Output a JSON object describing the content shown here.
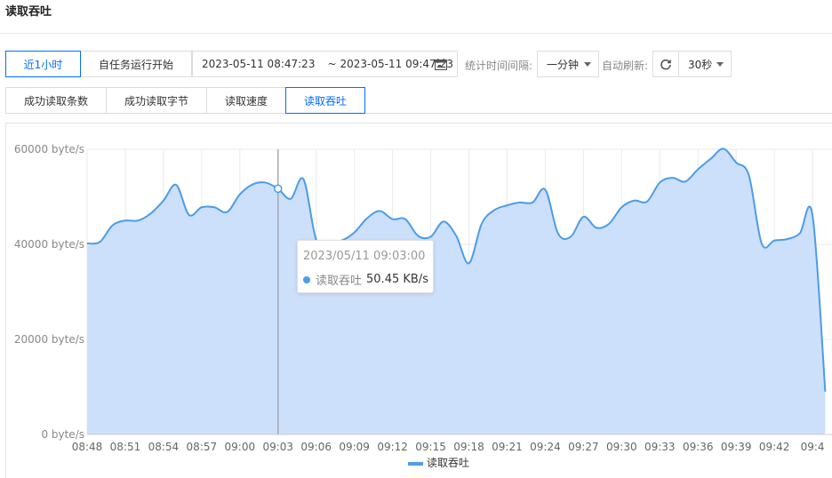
{
  "page": {
    "title": "读取吞吐"
  },
  "toolbar": {
    "range_buttons": [
      "近1小时",
      "自任务运行开始"
    ],
    "date_range": {
      "start": "2023-05-11 08:47:23",
      "separator": "~",
      "end": "2023-05-11 09:47:23"
    },
    "interval_label": "统计时间间隔:",
    "interval_value": "一分钟",
    "auto_refresh_label": "自动刷新:",
    "refresh_value": "30秒"
  },
  "tabs": [
    {
      "label": "成功读取条数",
      "active": false
    },
    {
      "label": "成功读取字节",
      "active": false
    },
    {
      "label": "读取速度",
      "active": false
    },
    {
      "label": "读取吞吐",
      "active": true
    }
  ],
  "colors": {
    "accent": "#006eff",
    "line": "#4c9ce8",
    "area": "#cce0fb",
    "grid": "#eaeaea"
  },
  "tooltip": {
    "time": "2023/05/11 09:03:00",
    "series": "读取吞吐",
    "value": "50.45 KB/s"
  },
  "chart_data": {
    "type": "area",
    "ylim": [
      0,
      60000
    ],
    "yticks": [
      "0 byte/s",
      "20000 byte/s",
      "40000 byte/s",
      "60000 byte/s"
    ],
    "ytick_values": [
      0,
      20000,
      40000,
      60000
    ],
    "xticks": [
      "08:48",
      "08:51",
      "08:54",
      "08:57",
      "09:00",
      "09:03",
      "09:06",
      "09:09",
      "09:12",
      "09:15",
      "09:18",
      "09:21",
      "09:24",
      "09:27",
      "09:30",
      "09:33",
      "09:36",
      "09:39",
      "09:42",
      "09:4"
    ],
    "xtick_minutes": [
      0,
      3,
      6,
      9,
      12,
      15,
      18,
      21,
      24,
      27,
      30,
      33,
      36,
      39,
      42,
      45,
      48,
      51,
      54,
      57
    ],
    "highlight_minute": 15,
    "grid": true,
    "legend_position": "bottom",
    "series": [
      {
        "name": "读取吞吐",
        "x": [
          "08:48",
          "08:49",
          "08:50",
          "08:51",
          "08:52",
          "08:53",
          "08:54",
          "08:55",
          "08:56",
          "08:57",
          "08:58",
          "08:59",
          "09:00",
          "09:01",
          "09:02",
          "09:03",
          "09:04",
          "09:05",
          "09:06",
          "09:07",
          "09:08",
          "09:09",
          "09:10",
          "09:11",
          "09:12",
          "09:13",
          "09:14",
          "09:15",
          "09:16",
          "09:17",
          "09:18",
          "09:19",
          "09:20",
          "09:21",
          "09:22",
          "09:23",
          "09:24",
          "09:25",
          "09:26",
          "09:27",
          "09:28",
          "09:29",
          "09:30",
          "09:31",
          "09:32",
          "09:33",
          "09:34",
          "09:35",
          "09:36",
          "09:37",
          "09:38",
          "09:39",
          "09:40",
          "09:41",
          "09:42",
          "09:43",
          "09:44",
          "09:45",
          "09:46"
        ],
        "values": [
          40200,
          40500,
          44000,
          45000,
          45000,
          46500,
          49200,
          52500,
          46200,
          47800,
          47800,
          46800,
          50500,
          52600,
          53000,
          51700,
          49600,
          53700,
          41000,
          40500,
          40800,
          42500,
          45500,
          47000,
          45300,
          45300,
          41800,
          41600,
          44800,
          41800,
          36000,
          44300,
          47200,
          48200,
          48800,
          48800,
          51500,
          42300,
          41600,
          45800,
          43500,
          44300,
          47800,
          49200,
          49000,
          53000,
          54000,
          53200,
          55800,
          58000,
          60100,
          57200,
          54500,
          40200,
          40800,
          41100,
          42300,
          46100,
          9000
        ]
      }
    ]
  }
}
